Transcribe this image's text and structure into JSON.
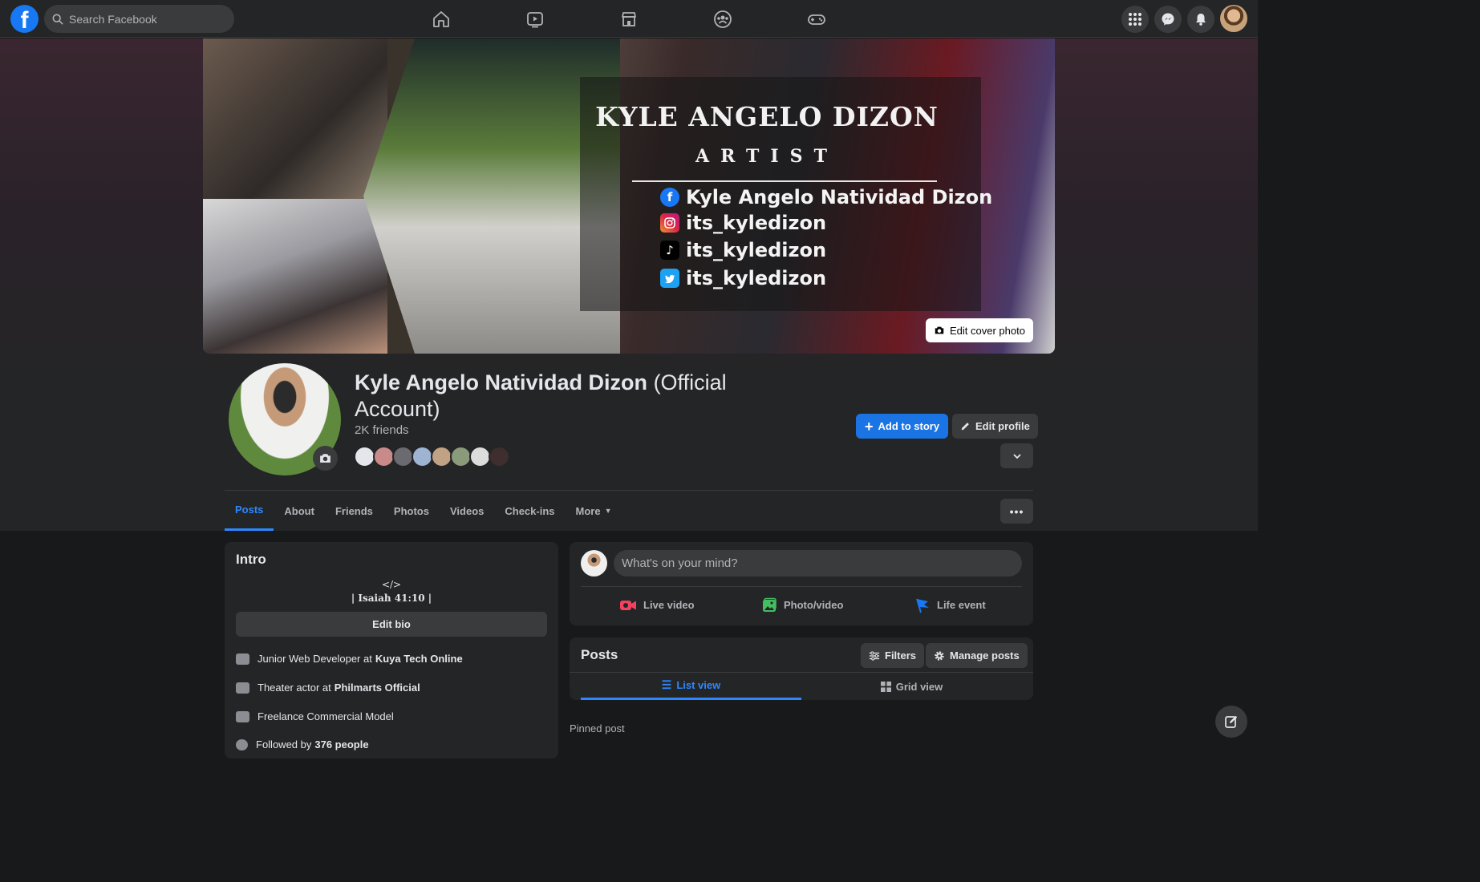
{
  "topbar": {
    "logo": "f",
    "search_placeholder": "Search Facebook",
    "nav_icons": [
      "home-icon",
      "watch-icon",
      "marketplace-icon",
      "groups-icon",
      "gaming-icon"
    ],
    "right_icons": [
      "menu-grid-icon",
      "messenger-icon",
      "notifications-icon"
    ]
  },
  "cover": {
    "name": "KYLE ANGELO DIZON",
    "role": "ARTIST",
    "socials": [
      {
        "icon": "facebook-icon",
        "handle": "Kyle Angelo Natividad Dizon",
        "color": "#1877f2"
      },
      {
        "icon": "instagram-icon",
        "handle": "its_kyledizon",
        "color": "#d6249f"
      },
      {
        "icon": "tiktok-icon",
        "handle": "its_kyledizon",
        "color": "#000000"
      },
      {
        "icon": "twitter-icon",
        "handle": "its_kyledizon",
        "color": "#1da1f2"
      }
    ],
    "edit_label": "Edit cover photo"
  },
  "profile": {
    "name": "Kyle Angelo Natividad Dizon",
    "name_suffix": "(Official Account)",
    "friends": "2K friends",
    "add_story": "Add to story",
    "edit_profile": "Edit profile"
  },
  "tabs": [
    "Posts",
    "About",
    "Friends",
    "Photos",
    "Videos",
    "Check-ins",
    "More"
  ],
  "intro": {
    "title": "Intro",
    "bio_line1": "</>",
    "bio_line2": "| Isaiah 41:10 |",
    "edit_bio": "Edit bio",
    "rows": [
      {
        "prefix": "Junior Web Developer at",
        "bold": "Kuya Tech Online"
      },
      {
        "prefix": "Theater actor at",
        "bold": "Philmarts Official"
      },
      {
        "prefix": "Freelance Commercial Model",
        "bold": ""
      },
      {
        "prefix": "Followed by",
        "bold": "376 people"
      }
    ]
  },
  "composer": {
    "placeholder": "What's on your mind?",
    "actions": [
      "Live video",
      "Photo/video",
      "Life event"
    ],
    "action_colors": [
      "#f3425f",
      "#45bd62",
      "#1877f2"
    ]
  },
  "posts": {
    "title": "Posts",
    "filters": "Filters",
    "manage": "Manage posts",
    "list_view": "List view",
    "grid_view": "Grid view",
    "pinned": "Pinned post"
  }
}
